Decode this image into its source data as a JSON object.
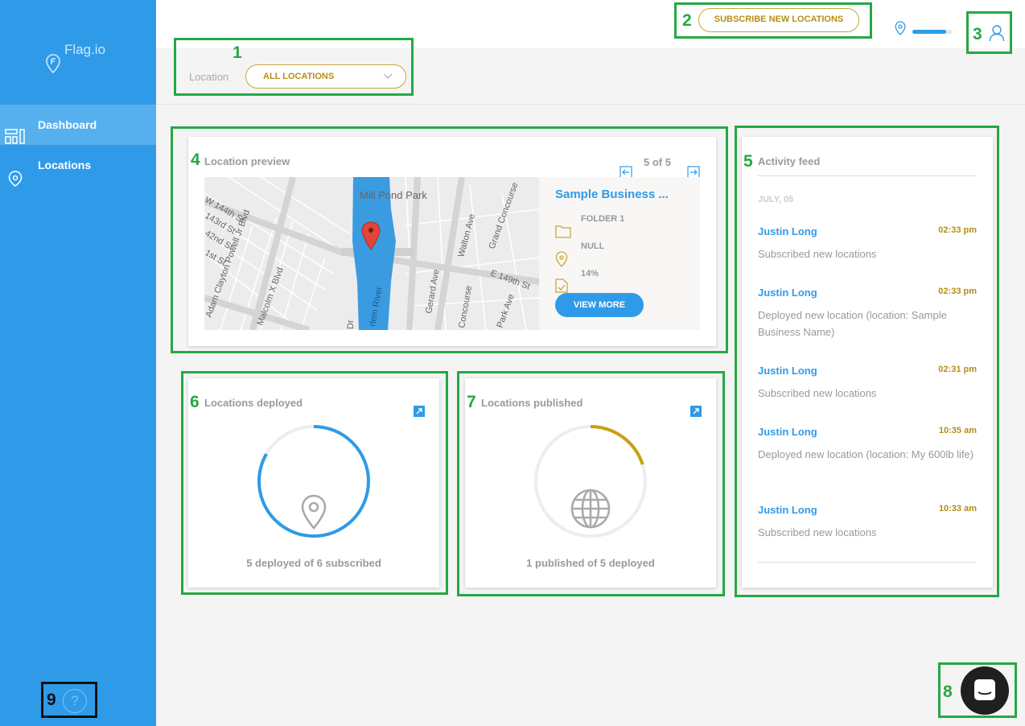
{
  "app": {
    "brand": "Flag.io"
  },
  "sidebar": {
    "items": [
      {
        "label": "Dashboard",
        "icon": "dashboard-icon",
        "active": true
      },
      {
        "label": "Locations",
        "icon": "location-pin-icon",
        "active": false
      }
    ],
    "help_symbol": "?"
  },
  "header": {
    "subscribe_label": "SUBSCRIBE NEW LOCATIONS",
    "usage_progress": 0.83
  },
  "filter": {
    "label": "Location",
    "selected": "ALL LOCATIONS"
  },
  "preview": {
    "title": "Location preview",
    "pager": "5 of 5",
    "business_name": "Sample Business ...",
    "folder": "FOLDER 1",
    "location_value": "NULL",
    "percent": "14%",
    "view_more_label": "VIEW MORE",
    "map_labels": {
      "park": "Mill Pond Park",
      "st_144": "W 144th St",
      "st_143": "143rd St",
      "st_142": "42nd St",
      "st_1st": "1st St",
      "powell": "Adam Clayton Powell Jr Blvd",
      "malcolm": "Malcolm X Blvd",
      "river": "rlem River",
      "dr": "Dr",
      "gerard": "Gerard Ave",
      "walton": "Walton Ave",
      "grand": "Grand Concourse",
      "e149": "E 149th St",
      "park_ave": "Park Ave",
      "concourse": "Concourse"
    }
  },
  "deployed": {
    "title": "Locations deployed",
    "caption": "5 deployed of 6 subscribed",
    "fraction": 0.833,
    "color": "#2f9be8"
  },
  "published": {
    "title": "Locations published",
    "caption": "1 published of 5 deployed",
    "fraction": 0.2,
    "color": "#c9a00e"
  },
  "activity": {
    "title": "Activity feed",
    "date": "JULY, 05",
    "items": [
      {
        "name": "Justin Long",
        "time": "02:33 pm",
        "text": "Subscribed new locations"
      },
      {
        "name": "Justin Long",
        "time": "02:33 pm",
        "text": "Deployed new location (location: Sample Business Name)"
      },
      {
        "name": "Justin Long",
        "time": "02:31 pm",
        "text": "Subscribed new locations"
      },
      {
        "name": "Justin Long",
        "time": "10:35 am",
        "text": "Deployed new location (location: My 600lb life)"
      },
      {
        "name": "Justin Long",
        "time": "10:33 am",
        "text": "Subscribed new locations"
      }
    ]
  },
  "annotations": [
    "1",
    "2",
    "3",
    "4",
    "5",
    "6",
    "7",
    "8",
    "9"
  ],
  "colors": {
    "primary": "#2f9be8",
    "gold": "#b58e16",
    "annotation": "#25a844"
  }
}
